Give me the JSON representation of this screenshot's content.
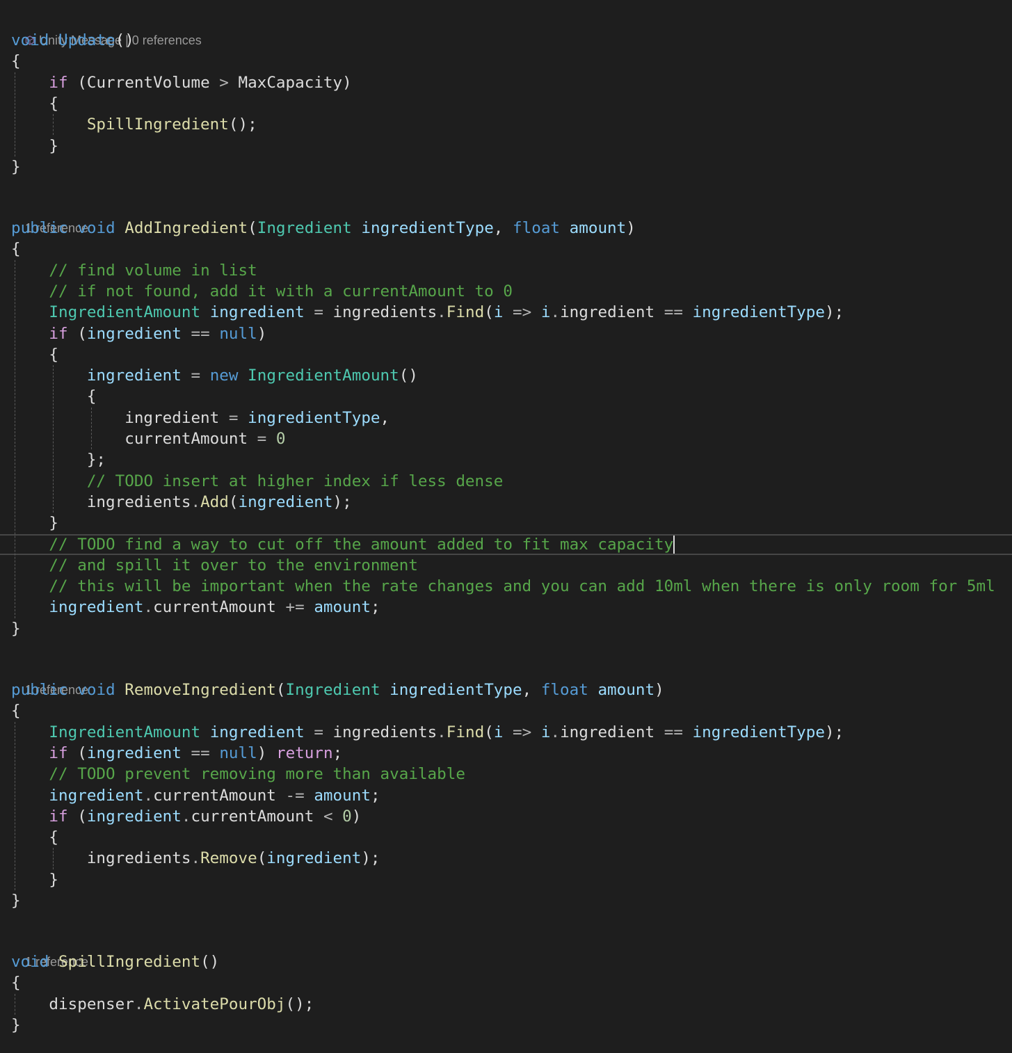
{
  "theme": {
    "background": "#1e1e1e",
    "keyword": "#569cd6",
    "control": "#d8a0df",
    "type": "#4ec9b0",
    "method": "#dcdcaa",
    "variable": "#9cdcfe",
    "number": "#b5cea8",
    "comment": "#57a64a",
    "operator": "#b4b4b4",
    "text": "#dcdcdc",
    "codelens": "#999999"
  },
  "codelens": [
    {
      "icon": "unity-message-icon",
      "text": "Unity Message | 0 references"
    },
    {
      "text": "1 reference"
    },
    {
      "text": "1 reference"
    },
    {
      "text": "1 reference"
    }
  ],
  "code_lines": [
    [
      [
        "kw",
        "void"
      ],
      [
        "plain",
        " "
      ],
      [
        "kw",
        "Update"
      ],
      [
        "plain",
        "()"
      ]
    ],
    [
      [
        "plain",
        "{"
      ]
    ],
    [
      [
        "plain",
        "    "
      ],
      [
        "ctl",
        "if"
      ],
      [
        "plain",
        " (CurrentVolume "
      ],
      [
        "op",
        ">"
      ],
      [
        "plain",
        " MaxCapacity)"
      ]
    ],
    [
      [
        "plain",
        "    {"
      ]
    ],
    [
      [
        "plain",
        "        "
      ],
      [
        "fn",
        "SpillIngredient"
      ],
      [
        "plain",
        "();"
      ]
    ],
    [
      [
        "plain",
        "    }"
      ]
    ],
    [
      [
        "plain",
        "}"
      ]
    ],
    [
      [
        "kw",
        "public"
      ],
      [
        "plain",
        " "
      ],
      [
        "kw",
        "void"
      ],
      [
        "plain",
        " "
      ],
      [
        "fn",
        "AddIngredient"
      ],
      [
        "plain",
        "("
      ],
      [
        "type",
        "Ingredient"
      ],
      [
        "plain",
        " "
      ],
      [
        "var",
        "ingredientType"
      ],
      [
        "plain",
        ", "
      ],
      [
        "kw",
        "float"
      ],
      [
        "plain",
        " "
      ],
      [
        "var",
        "amount"
      ],
      [
        "plain",
        ")"
      ]
    ],
    [
      [
        "plain",
        "{"
      ]
    ],
    [
      [
        "plain",
        "    "
      ],
      [
        "com",
        "// find volume in list"
      ]
    ],
    [
      [
        "plain",
        "    "
      ],
      [
        "com",
        "// if not found, add it with a currentAmount to 0"
      ]
    ],
    [
      [
        "plain",
        "    "
      ],
      [
        "type",
        "IngredientAmount"
      ],
      [
        "plain",
        " "
      ],
      [
        "var",
        "ingredient"
      ],
      [
        "plain",
        " "
      ],
      [
        "op",
        "="
      ],
      [
        "plain",
        " ingredients"
      ],
      [
        "op",
        "."
      ],
      [
        "fn",
        "Find"
      ],
      [
        "plain",
        "("
      ],
      [
        "var",
        "i"
      ],
      [
        "plain",
        " "
      ],
      [
        "op",
        "=>"
      ],
      [
        "plain",
        " "
      ],
      [
        "var",
        "i"
      ],
      [
        "op",
        "."
      ],
      [
        "plain",
        "ingredient "
      ],
      [
        "op",
        "=="
      ],
      [
        "plain",
        " "
      ],
      [
        "var",
        "ingredientType"
      ],
      [
        "plain",
        ");"
      ]
    ],
    [
      [
        "plain",
        "    "
      ],
      [
        "ctl",
        "if"
      ],
      [
        "plain",
        " ("
      ],
      [
        "var",
        "ingredient"
      ],
      [
        "plain",
        " "
      ],
      [
        "op",
        "=="
      ],
      [
        "plain",
        " "
      ],
      [
        "kw",
        "null"
      ],
      [
        "plain",
        ")"
      ]
    ],
    [
      [
        "plain",
        "    {"
      ]
    ],
    [
      [
        "plain",
        "        "
      ],
      [
        "var",
        "ingredient"
      ],
      [
        "plain",
        " "
      ],
      [
        "op",
        "="
      ],
      [
        "plain",
        " "
      ],
      [
        "kw",
        "new"
      ],
      [
        "plain",
        " "
      ],
      [
        "type",
        "IngredientAmount"
      ],
      [
        "plain",
        "()"
      ]
    ],
    [
      [
        "plain",
        "        {"
      ]
    ],
    [
      [
        "plain",
        "            ingredient "
      ],
      [
        "op",
        "="
      ],
      [
        "plain",
        " "
      ],
      [
        "var",
        "ingredientType"
      ],
      [
        "plain",
        ","
      ]
    ],
    [
      [
        "plain",
        "            currentAmount "
      ],
      [
        "op",
        "="
      ],
      [
        "plain",
        " "
      ],
      [
        "num",
        "0"
      ]
    ],
    [
      [
        "plain",
        "        };"
      ]
    ],
    [
      [
        "plain",
        "        "
      ],
      [
        "com",
        "// TODO insert at higher index if less dense"
      ]
    ],
    [
      [
        "plain",
        "        ingredients"
      ],
      [
        "op",
        "."
      ],
      [
        "fn",
        "Add"
      ],
      [
        "plain",
        "("
      ],
      [
        "var",
        "ingredient"
      ],
      [
        "plain",
        ");"
      ]
    ],
    [
      [
        "plain",
        "    }"
      ]
    ],
    [
      [
        "plain",
        "    "
      ],
      [
        "com",
        "// TODO find a way to cut off the amount added to fit max capacity"
      ]
    ],
    [
      [
        "plain",
        "    "
      ],
      [
        "com",
        "// and spill it over to the environment"
      ]
    ],
    [
      [
        "plain",
        "    "
      ],
      [
        "com",
        "// this will be important when the rate changes and you can add 10ml when there is only room for 5ml"
      ]
    ],
    [
      [
        "plain",
        "    "
      ],
      [
        "var",
        "ingredient"
      ],
      [
        "op",
        "."
      ],
      [
        "plain",
        "currentAmount "
      ],
      [
        "op",
        "+="
      ],
      [
        "plain",
        " "
      ],
      [
        "var",
        "amount"
      ],
      [
        "plain",
        ";"
      ]
    ],
    [
      [
        "plain",
        "}"
      ]
    ],
    [
      [
        "kw",
        "public"
      ],
      [
        "plain",
        " "
      ],
      [
        "kw",
        "void"
      ],
      [
        "plain",
        " "
      ],
      [
        "fn",
        "RemoveIngredient"
      ],
      [
        "plain",
        "("
      ],
      [
        "type",
        "Ingredient"
      ],
      [
        "plain",
        " "
      ],
      [
        "var",
        "ingredientType"
      ],
      [
        "plain",
        ", "
      ],
      [
        "kw",
        "float"
      ],
      [
        "plain",
        " "
      ],
      [
        "var",
        "amount"
      ],
      [
        "plain",
        ")"
      ]
    ],
    [
      [
        "plain",
        "{"
      ]
    ],
    [
      [
        "plain",
        "    "
      ],
      [
        "type",
        "IngredientAmount"
      ],
      [
        "plain",
        " "
      ],
      [
        "var",
        "ingredient"
      ],
      [
        "plain",
        " "
      ],
      [
        "op",
        "="
      ],
      [
        "plain",
        " ingredients"
      ],
      [
        "op",
        "."
      ],
      [
        "fn",
        "Find"
      ],
      [
        "plain",
        "("
      ],
      [
        "var",
        "i"
      ],
      [
        "plain",
        " "
      ],
      [
        "op",
        "=>"
      ],
      [
        "plain",
        " "
      ],
      [
        "var",
        "i"
      ],
      [
        "op",
        "."
      ],
      [
        "plain",
        "ingredient "
      ],
      [
        "op",
        "=="
      ],
      [
        "plain",
        " "
      ],
      [
        "var",
        "ingredientType"
      ],
      [
        "plain",
        ");"
      ]
    ],
    [
      [
        "plain",
        "    "
      ],
      [
        "ctl",
        "if"
      ],
      [
        "plain",
        " ("
      ],
      [
        "var",
        "ingredient"
      ],
      [
        "plain",
        " "
      ],
      [
        "op",
        "=="
      ],
      [
        "plain",
        " "
      ],
      [
        "kw",
        "null"
      ],
      [
        "plain",
        ") "
      ],
      [
        "ctl",
        "return"
      ],
      [
        "plain",
        ";"
      ]
    ],
    [
      [
        "plain",
        "    "
      ],
      [
        "com",
        "// TODO prevent removing more than available"
      ]
    ],
    [
      [
        "plain",
        "    "
      ],
      [
        "var",
        "ingredient"
      ],
      [
        "op",
        "."
      ],
      [
        "plain",
        "currentAmount "
      ],
      [
        "op",
        "-="
      ],
      [
        "plain",
        " "
      ],
      [
        "var",
        "amount"
      ],
      [
        "plain",
        ";"
      ]
    ],
    [
      [
        "plain",
        "    "
      ],
      [
        "ctl",
        "if"
      ],
      [
        "plain",
        " ("
      ],
      [
        "var",
        "ingredient"
      ],
      [
        "op",
        "."
      ],
      [
        "plain",
        "currentAmount "
      ],
      [
        "op",
        "<"
      ],
      [
        "plain",
        " "
      ],
      [
        "num",
        "0"
      ],
      [
        "plain",
        ")"
      ]
    ],
    [
      [
        "plain",
        "    {"
      ]
    ],
    [
      [
        "plain",
        "        ingredients"
      ],
      [
        "op",
        "."
      ],
      [
        "fn",
        "Remove"
      ],
      [
        "plain",
        "("
      ],
      [
        "var",
        "ingredient"
      ],
      [
        "plain",
        ");"
      ]
    ],
    [
      [
        "plain",
        "    }"
      ]
    ],
    [
      [
        "plain",
        "}"
      ]
    ],
    [
      [
        "kw",
        "void"
      ],
      [
        "plain",
        " "
      ],
      [
        "fn",
        "SpillIngredient"
      ],
      [
        "plain",
        "()"
      ]
    ],
    [
      [
        "plain",
        "{"
      ]
    ],
    [
      [
        "plain",
        "    dispenser"
      ],
      [
        "op",
        "."
      ],
      [
        "fn",
        "ActivatePourObj"
      ],
      [
        "plain",
        "();"
      ]
    ],
    [
      [
        "plain",
        "}"
      ]
    ]
  ]
}
